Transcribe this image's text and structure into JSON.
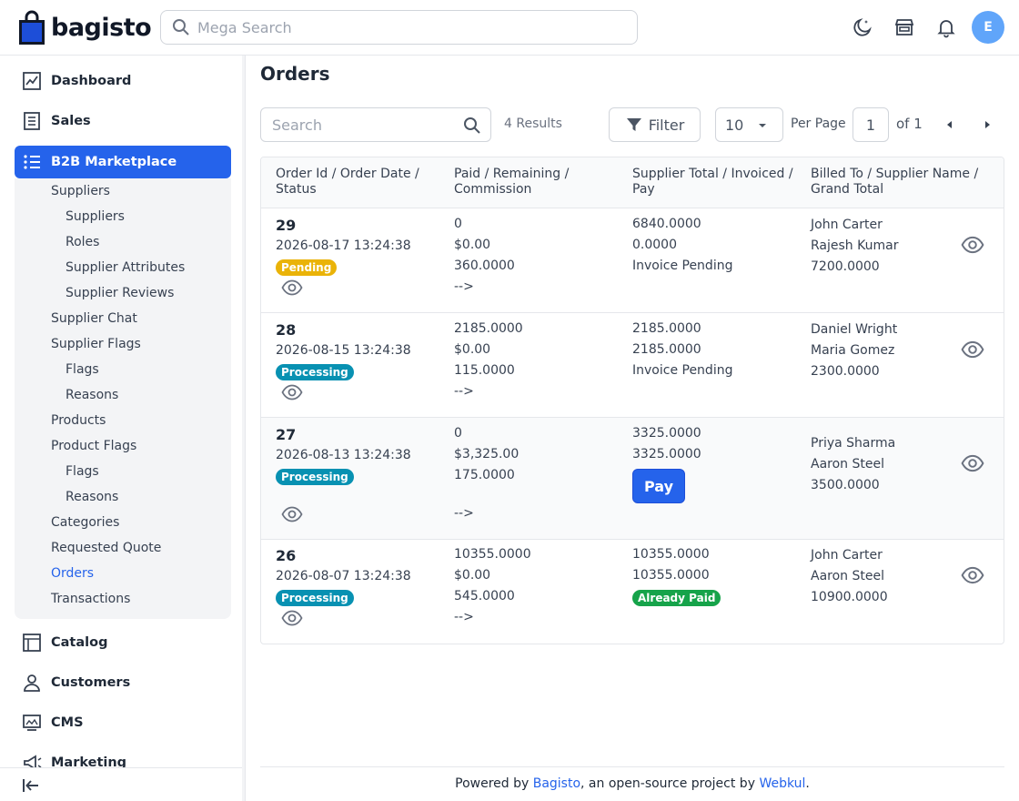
{
  "brand": {
    "name": "bagisto"
  },
  "header": {
    "search_placeholder": "Mega Search",
    "avatar_initial": "E"
  },
  "sidebar": {
    "main_items": [
      {
        "label": "Dashboard",
        "icon": "dashboard-icon"
      },
      {
        "label": "Sales",
        "icon": "sales-icon"
      },
      {
        "label": "B2B Marketplace",
        "icon": "marketplace-icon"
      },
      {
        "label": "Catalog",
        "icon": "catalog-icon"
      },
      {
        "label": "Customers",
        "icon": "customers-icon"
      },
      {
        "label": "CMS",
        "icon": "cms-icon"
      },
      {
        "label": "Marketing",
        "icon": "marketing-icon"
      }
    ],
    "sub_items": [
      {
        "label": "Suppliers",
        "level": 1
      },
      {
        "label": "Suppliers",
        "level": 2
      },
      {
        "label": "Roles",
        "level": 2
      },
      {
        "label": "Supplier Attributes",
        "level": 2
      },
      {
        "label": "Supplier Reviews",
        "level": 2
      },
      {
        "label": "Supplier Chat",
        "level": 1
      },
      {
        "label": "Supplier Flags",
        "level": 1
      },
      {
        "label": "Flags",
        "level": 2
      },
      {
        "label": "Reasons",
        "level": 2
      },
      {
        "label": "Products",
        "level": 1
      },
      {
        "label": "Product Flags",
        "level": 1
      },
      {
        "label": "Flags",
        "level": 2
      },
      {
        "label": "Reasons",
        "level": 2
      },
      {
        "label": "Categories",
        "level": 1
      },
      {
        "label": "Requested Quote",
        "level": 1
      },
      {
        "label": "Orders",
        "level": 1,
        "active": true
      },
      {
        "label": "Transactions",
        "level": 1
      }
    ]
  },
  "page": {
    "title": "Orders"
  },
  "toolbar": {
    "search_placeholder": "Search",
    "results": "4 Results",
    "filter_label": "Filter",
    "per_page_value": "10",
    "per_page_label": "Per Page",
    "page_value": "1",
    "of_label": "of 1"
  },
  "table": {
    "headers": [
      "Order Id / Order Date / Status",
      "Paid / Remaining / Commission",
      "Supplier Total / Invoiced / Pay",
      "Billed To / Supplier Name / Grand Total"
    ],
    "rows": [
      {
        "id": "29",
        "date": "2026-08-17 13:24:38",
        "status": "Pending",
        "paid": "0",
        "remaining": "$0.00",
        "commission": "360.0000",
        "arrow": "-->",
        "supplier_total": "6840.0000",
        "invoiced": "0.0000",
        "pay": "Invoice Pending",
        "billed_to": "John Carter",
        "supplier_name": "Rajesh Kumar",
        "grand_total": "7200.0000"
      },
      {
        "id": "28",
        "date": "2026-08-15 13:24:38",
        "status": "Processing",
        "paid": "2185.0000",
        "remaining": "$0.00",
        "commission": "115.0000",
        "arrow": "-->",
        "supplier_total": "2185.0000",
        "invoiced": "2185.0000",
        "pay": "Invoice Pending",
        "billed_to": "Daniel Wright",
        "supplier_name": "Maria Gomez",
        "grand_total": "2300.0000"
      },
      {
        "id": "27",
        "date": "2026-08-13 13:24:38",
        "status": "Processing",
        "paid": "0",
        "remaining": "$3,325.00",
        "commission": "175.0000",
        "arrow": "-->",
        "supplier_total": "3325.0000",
        "invoiced": "3325.0000",
        "pay": "Pay",
        "billed_to": "Priya Sharma",
        "supplier_name": "Aaron Steel",
        "grand_total": "3500.0000"
      },
      {
        "id": "26",
        "date": "2026-08-07 13:24:38",
        "status": "Processing",
        "paid": "10355.0000",
        "remaining": "$0.00",
        "commission": "545.0000",
        "arrow": "-->",
        "supplier_total": "10355.0000",
        "invoiced": "10355.0000",
        "pay": "Already Paid",
        "billed_to": "John Carter",
        "supplier_name": "Aaron Steel",
        "grand_total": "10900.0000"
      }
    ]
  },
  "footer": {
    "prefix": "Powered by ",
    "link1": "Bagisto",
    "middle": ", an open-source project by ",
    "link2": "Webkul",
    "suffix": "."
  },
  "colors": {
    "primary": "#2563eb",
    "pending": "#eab308",
    "processing": "#0891b2",
    "paid": "#16a34a"
  }
}
